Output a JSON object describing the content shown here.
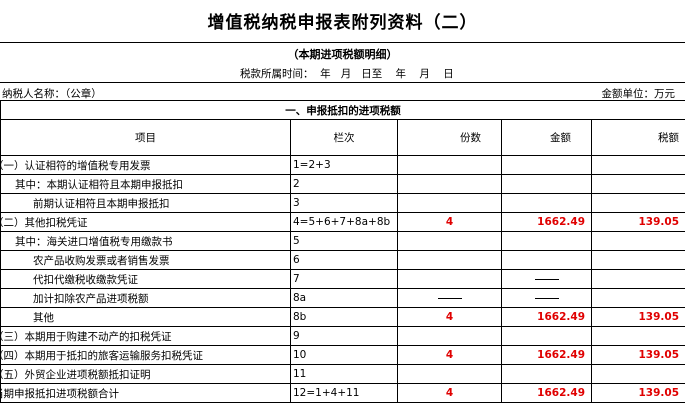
{
  "title": "增值税纳税申报表附列资料（二）",
  "subtitle": "（本期进项税额明细）",
  "period": "税款所属时间：  年   月   日至    年    月    日",
  "taxpayer": "纳税人名称：（公章）",
  "unit": "金额单位：万元",
  "section": "一、申报抵扣的进项税额",
  "headers": {
    "item": "项目",
    "col": "栏次",
    "count": "份数",
    "amount": "金额",
    "tax": "税额"
  },
  "rows": [
    {
      "item": "（一）认证相符的增值税专用发票",
      "col": "1=2+3",
      "count": "",
      "amount": "",
      "tax": ""
    },
    {
      "item": "其中：本期认证相符且本期申报抵扣",
      "col": "2",
      "count": "",
      "amount": "",
      "tax": ""
    },
    {
      "item": "前期认证相符且本期申报抵扣",
      "col": "3",
      "count": "",
      "amount": "",
      "tax": ""
    },
    {
      "item": "（二）其他扣税凭证",
      "col": "4=5+6+7+8a+8b",
      "count": "4",
      "amount": "1662.49",
      "tax": "139.05"
    },
    {
      "item": "其中：海关进口增值税专用缴款书",
      "col": "5",
      "count": "",
      "amount": "",
      "tax": ""
    },
    {
      "item": "农产品收购发票或者销售发票",
      "col": "6",
      "count": "",
      "amount": "",
      "tax": ""
    },
    {
      "item": "代扣代缴税收缴款凭证",
      "col": "7",
      "count": "",
      "amount": "",
      "tax": ""
    },
    {
      "item": "加计扣除农产品进项税额",
      "col": "8a",
      "count": "",
      "amount": "",
      "tax": ""
    },
    {
      "item": "其他",
      "col": "8b",
      "count": "4",
      "amount": "1662.49",
      "tax": "139.05"
    },
    {
      "item": "（三）本期用于购建不动产的扣税凭证",
      "col": "9",
      "count": "",
      "amount": "",
      "tax": ""
    },
    {
      "item": "（四）本期用于抵扣的旅客运输服务扣税凭证",
      "col": "10",
      "count": "4",
      "amount": "1662.49",
      "tax": "139.05"
    },
    {
      "item": "（五）外贸企业进项税额抵扣证明",
      "col": "11",
      "count": "",
      "amount": "",
      "tax": ""
    },
    {
      "item": "当期申报抵扣进项税额合计",
      "col": "12=1+4+11",
      "count": "4",
      "amount": "1662.49",
      "tax": "139.05"
    }
  ]
}
